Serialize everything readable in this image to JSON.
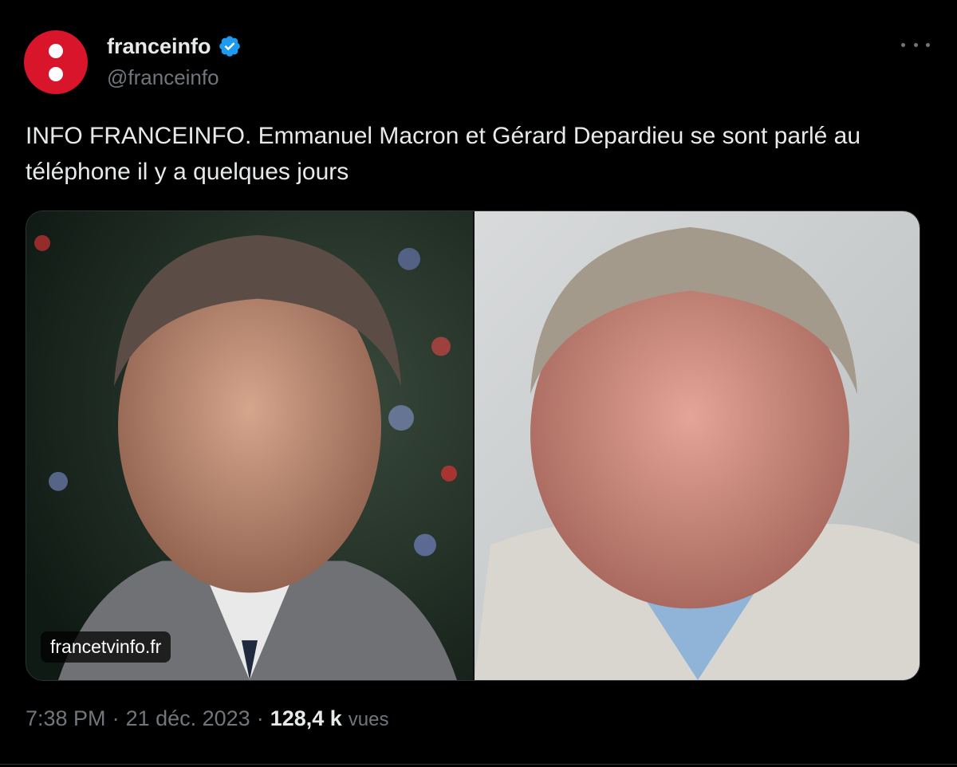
{
  "account": {
    "display_name": "franceinfo",
    "handle": "@franceinfo",
    "verified": true,
    "avatar_color": "#d9152b"
  },
  "tweet": {
    "text": "INFO FRANCEINFO. Emmanuel Macron et Gérard Depardieu se sont parlé au téléphone il y a quelques jours",
    "media": {
      "source_badge": "francetvinfo.fr"
    },
    "time": "7:38 PM",
    "date": "21 déc. 2023",
    "views_count": "128,4 k",
    "views_label": "vues"
  },
  "icons": {
    "more": "more-icon",
    "verified": "verified-badge-icon"
  },
  "colors": {
    "background": "#000000",
    "text_primary": "#e7e9ea",
    "text_secondary": "#71767b",
    "verified_blue": "#1d9bf0"
  }
}
